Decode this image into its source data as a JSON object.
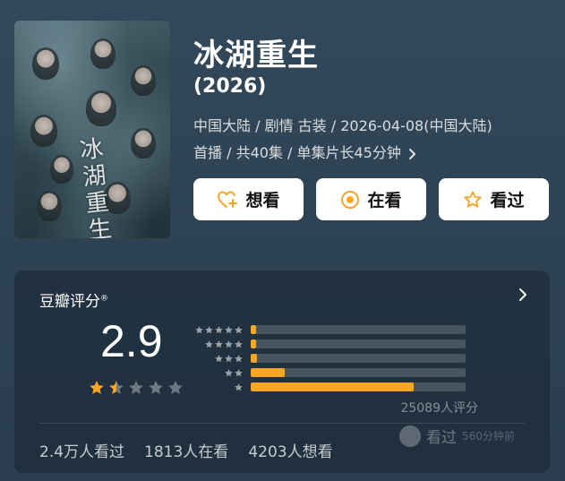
{
  "movie": {
    "title": "冰湖重生",
    "year": "(2026)",
    "meta_line1": "中国大陆 / 剧情 古装 / 2026-04-08(中国大陆)",
    "meta_line2": "首播 / 共40集 / 单集片长45分钟",
    "poster_art_text": "冰湖重生"
  },
  "actions": {
    "want_label": "想看",
    "watching_label": "在看",
    "watched_label": "看过"
  },
  "rating": {
    "card_title": "豆瓣评分",
    "score": "2.9",
    "score_stars": 1.5,
    "distribution": [
      {
        "stars": 5,
        "percent": 2.5
      },
      {
        "stars": 4,
        "percent": 2.5
      },
      {
        "stars": 3,
        "percent": 3.0
      },
      {
        "stars": 2,
        "percent": 16.0
      },
      {
        "stars": 1,
        "percent": 76.0
      }
    ],
    "rating_count": "25089人评分"
  },
  "stats": {
    "watched": "2.4万人看过",
    "watching": "1813人在看",
    "wish": "4203人想看"
  },
  "watermark": {
    "text": "看过",
    "sub": "560分钟前"
  },
  "colors": {
    "accent": "#f5a623",
    "background": "#2e4354"
  },
  "icons": {
    "want": "heart-plus-icon",
    "watching": "target-icon",
    "watched": "star-outline-icon",
    "more": "chevron-right-icon"
  }
}
